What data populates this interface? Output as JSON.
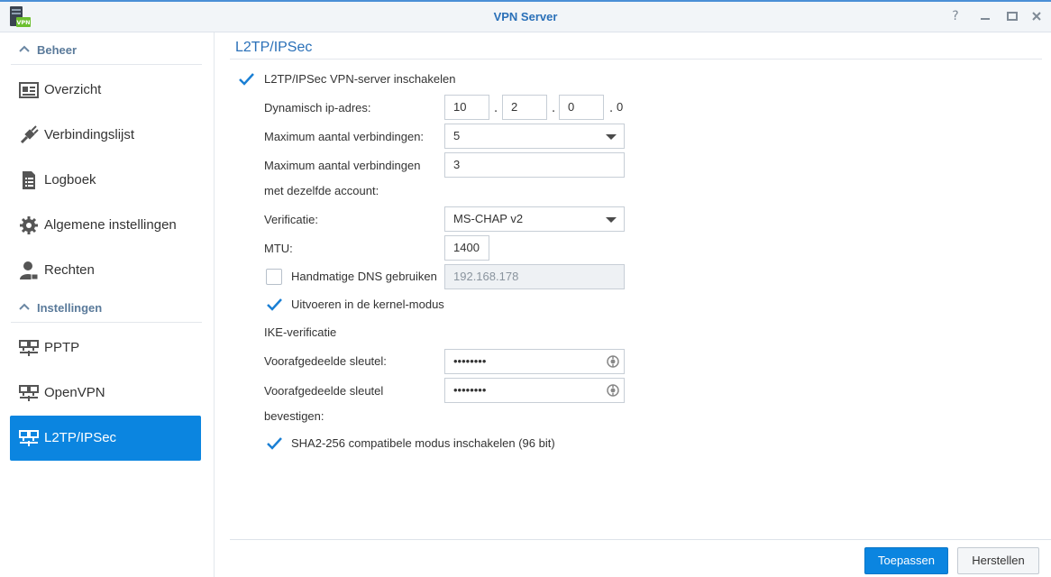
{
  "window": {
    "title": "VPN Server",
    "controls": [
      "help-icon",
      "minimize-icon",
      "maximize-icon",
      "close-icon"
    ],
    "app_icon_badge": "VPN"
  },
  "sidebar": {
    "sections": [
      {
        "label": "Beheer",
        "items": [
          {
            "label": "Overzicht",
            "icon": "overview-icon"
          },
          {
            "label": "Verbindingslijst",
            "icon": "connection-list-icon"
          },
          {
            "label": "Logboek",
            "icon": "log-icon"
          },
          {
            "label": "Algemene instellingen",
            "icon": "gear-icon"
          },
          {
            "label": "Rechten",
            "icon": "user-permissions-icon"
          }
        ]
      },
      {
        "label": "Instellingen",
        "items": [
          {
            "label": "PPTP",
            "icon": "network-icon"
          },
          {
            "label": "OpenVPN",
            "icon": "network-icon"
          },
          {
            "label": "L2TP/IPSec",
            "icon": "network-icon",
            "active": true
          }
        ]
      }
    ]
  },
  "main": {
    "title": "L2TP/IPSec",
    "enable_label": "L2TP/IPSec VPN-server inschakelen",
    "enable_checked": true,
    "dynamic_ip": {
      "label": "Dynamisch ip-adres:",
      "octet1": "10",
      "octet2": "2",
      "octet3": "0",
      "octet4": "0",
      "dot": "."
    },
    "max_connections": {
      "label": "Maximum aantal verbindingen:",
      "value": "5"
    },
    "max_connections_account": {
      "label_line1": "Maximum aantal verbindingen",
      "label_line2": "met dezelfde account:",
      "value": "3"
    },
    "verification": {
      "label": "Verificatie:",
      "value": "MS-CHAP v2"
    },
    "mtu": {
      "label": "MTU:",
      "value": "1400"
    },
    "manual_dns": {
      "label": "Handmatige DNS gebruiken",
      "checked": false,
      "value": "192.168.178"
    },
    "kernel_mode": {
      "label": "Uitvoeren in de kernel-modus",
      "checked": true
    },
    "ike_heading": "IKE-verificatie",
    "psk": {
      "label": "Voorafgedeelde sleutel:",
      "value": "••••••••"
    },
    "psk_confirm": {
      "label_line1": "Voorafgedeelde sleutel",
      "label_line2": "bevestigen:",
      "value": "••••••••"
    },
    "sha2": {
      "label": "SHA2-256 compatibele modus inschakelen (96 bit)",
      "checked": true
    }
  },
  "footer": {
    "apply_label": "Toepassen",
    "reset_label": "Herstellen"
  },
  "colors": {
    "accent": "#0b85e0",
    "title_blue": "#2a70b8",
    "check_blue": "#1a7fd4"
  }
}
